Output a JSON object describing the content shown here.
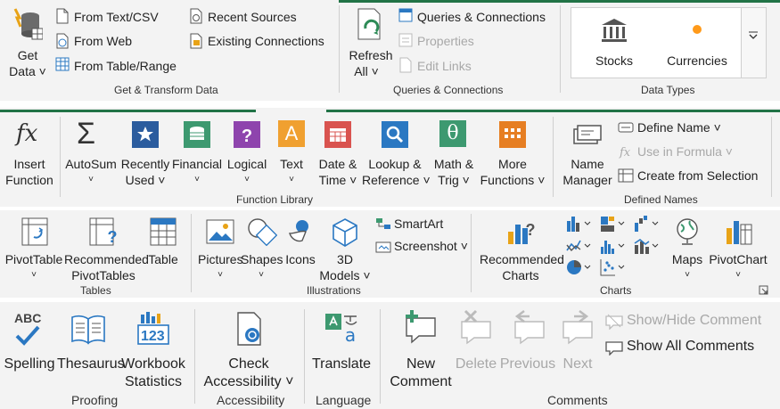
{
  "data_tab": {
    "get_data": {
      "line1": "Get",
      "line2": "Data ˅"
    },
    "from_text_csv": "From Text/CSV",
    "from_web": "From Web",
    "from_table_range": "From Table/Range",
    "recent_sources": "Recent Sources",
    "existing_connections": "Existing Connections",
    "get_transform_group": "Get & Transform Data",
    "refresh_all": {
      "line1": "Refresh",
      "line2": "All ˅"
    },
    "queries_connections": "Queries & Connections",
    "properties": "Properties",
    "edit_links": "Edit Links",
    "queries_group": "Queries & Connections",
    "stocks": "Stocks",
    "currencies": "Currencies",
    "data_types_group": "Data Types"
  },
  "formulas_tab": {
    "insert_function": {
      "line1": "Insert",
      "line2": "Function"
    },
    "autosum": {
      "line1": "AutoSum",
      "line2": "˅"
    },
    "recently_used": {
      "line1": "Recently",
      "line2": "Used ˅"
    },
    "financial": {
      "line1": "Financial",
      "line2": "˅"
    },
    "logical": {
      "line1": "Logical",
      "line2": "˅"
    },
    "text": {
      "line1": "Text",
      "line2": "˅"
    },
    "date_time": {
      "line1": "Date &",
      "line2": "Time ˅"
    },
    "lookup_reference": {
      "line1": "Lookup &",
      "line2": "Reference ˅"
    },
    "math_trig": {
      "line1": "Math &",
      "line2": "Trig ˅"
    },
    "more_functions": {
      "line1": "More",
      "line2": "Functions ˅"
    },
    "function_library_group": "Function Library",
    "name_manager": {
      "line1": "Name",
      "line2": "Manager"
    },
    "define_name": "Define Name ˅",
    "use_in_formula": "Use in Formula ˅",
    "create_from_selection": "Create from Selection",
    "defined_names_group": "Defined Names"
  },
  "insert_tab": {
    "pivottable": {
      "line1": "PivotTable",
      "line2": "˅"
    },
    "recommended_pivottables": {
      "line1": "Recommended",
      "line2": "PivotTables"
    },
    "table": "Table",
    "tables_group": "Tables",
    "pictures": {
      "line1": "Pictures",
      "line2": "˅"
    },
    "shapes": {
      "line1": "Shapes",
      "line2": "˅"
    },
    "icons": "Icons",
    "models_3d": {
      "line1": "3D",
      "line2": "Models ˅"
    },
    "smartart": "SmartArt",
    "screenshot": "Screenshot ˅",
    "illustrations_group": "Illustrations",
    "recommended_charts": {
      "line1": "Recommended",
      "line2": "Charts"
    },
    "maps": {
      "line1": "Maps",
      "line2": "˅"
    },
    "pivotchart": {
      "line1": "PivotChart",
      "line2": "˅"
    },
    "charts_group": "Charts"
  },
  "review_tab": {
    "spelling": "Spelling",
    "thesaurus": "Thesaurus",
    "workbook_statistics": {
      "line1": "Workbook",
      "line2": "Statistics"
    },
    "proofing_group": "Proofing",
    "check_accessibility": {
      "line1": "Check",
      "line2": "Accessibility ˅"
    },
    "accessibility_group": "Accessibility",
    "translate": "Translate",
    "language_group": "Language",
    "new_comment": {
      "line1": "New",
      "line2": "Comment"
    },
    "delete": "Delete",
    "previous": "Previous",
    "next": "Next",
    "show_hide_comment": "Show/Hide Comment",
    "show_all_comments": "Show All Comments",
    "comments_group": "Comments"
  },
  "icon_glyphs": {
    "fx": "fx",
    "sigma": "Σ",
    "abc": "ABC",
    "num123": "123",
    "text_a": "A",
    "theta": "θ",
    "chevron": "˅"
  },
  "colors": {
    "accent_green": "#217346",
    "ribbon_bg": "#f3f3f3",
    "separator": "#cfcfcf",
    "disabled": "#a8a8a8"
  }
}
